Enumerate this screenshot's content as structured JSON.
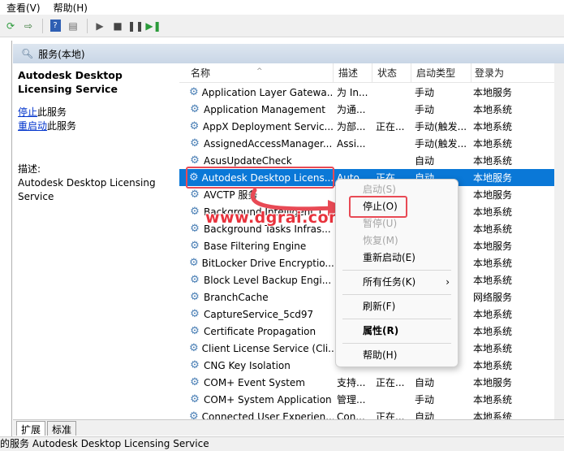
{
  "menubar": {
    "view": "查看(V)",
    "help": "帮助(H)"
  },
  "header": {
    "title": "服务(本地)"
  },
  "leftpane": {
    "service_name": "Autodesk Desktop Licensing Service",
    "stop_link": "停止",
    "stop_suffix": "此服务",
    "restart_link": "重启动",
    "restart_suffix": "此服务",
    "desc_label": "描述:",
    "desc_text": "Autodesk Desktop Licensing Service"
  },
  "columns": {
    "name": "名称",
    "desc": "描述",
    "status": "状态",
    "startup": "启动类型",
    "login": "登录为"
  },
  "rows": [
    {
      "name": "Application Layer Gatewa...",
      "desc": "为 In...",
      "status": "",
      "startup": "手动",
      "login": "本地服务"
    },
    {
      "name": "Application Management",
      "desc": "为通...",
      "status": "",
      "startup": "手动",
      "login": "本地系统"
    },
    {
      "name": "AppX Deployment Servic...",
      "desc": "为部...",
      "status": "正在...",
      "startup": "手动(触发...",
      "login": "本地系统"
    },
    {
      "name": "AssignedAccessManager...",
      "desc": "Assi...",
      "status": "",
      "startup": "手动(触发...",
      "login": "本地系统"
    },
    {
      "name": "AsusUpdateCheck",
      "desc": "",
      "status": "",
      "startup": "自动",
      "login": "本地系统"
    },
    {
      "name": "Autodesk Desktop Licens...",
      "desc": "Auto...",
      "status": "正在...",
      "startup": "自动",
      "login": "本地服务"
    },
    {
      "name": "AVCTP 服务",
      "desc": "",
      "status": "",
      "startup": "",
      "login": "本地服务"
    },
    {
      "name": "Background Intelligent T...",
      "desc": "",
      "status": "",
      "startup": "",
      "login": "本地系统"
    },
    {
      "name": "Background Tasks Infras...",
      "desc": "",
      "status": "",
      "startup": "",
      "login": "本地系统"
    },
    {
      "name": "Base Filtering Engine",
      "desc": "",
      "status": "",
      "startup": "",
      "login": "本地服务"
    },
    {
      "name": "BitLocker Drive Encryptio...",
      "desc": "",
      "status": "",
      "startup": "",
      "login": "本地系统"
    },
    {
      "name": "Block Level Backup Engi...",
      "desc": "",
      "status": "",
      "startup": "",
      "login": "本地系统"
    },
    {
      "name": "BranchCache",
      "desc": "",
      "status": "",
      "startup": "",
      "login": "网络服务"
    },
    {
      "name": "CaptureService_5cd97",
      "desc": "",
      "status": "",
      "startup": "",
      "login": "本地系统"
    },
    {
      "name": "Certificate Propagation",
      "desc": "",
      "status": "",
      "startup": "",
      "login": "本地系统"
    },
    {
      "name": "Client License Service (Cli...",
      "desc": "",
      "status": "",
      "startup": "",
      "login": "本地系统"
    },
    {
      "name": "CNG Key Isolation",
      "desc": "",
      "status": "",
      "startup": "",
      "login": "本地系统"
    },
    {
      "name": "COM+ Event System",
      "desc": "支持...",
      "status": "正在...",
      "startup": "自动",
      "login": "本地服务"
    },
    {
      "name": "COM+ System Application",
      "desc": "管理...",
      "status": "",
      "startup": "手动",
      "login": "本地系统"
    },
    {
      "name": "Connected User Experien...",
      "desc": "Con...",
      "status": "正在...",
      "startup": "自动",
      "login": "本地系统"
    }
  ],
  "contextmenu": {
    "start": "启动(S)",
    "stop": "停止(O)",
    "pause": "暂停(U)",
    "resume": "恢复(M)",
    "restart": "重新启动(E)",
    "alltasks": "所有任务(K)",
    "refresh": "刷新(F)",
    "properties": "属性(R)",
    "help": "帮助(H)"
  },
  "watermark": "www.dgrai.com",
  "tabs": {
    "extended": "扩展",
    "standard": "标准"
  },
  "statusbar": {
    "text": "的服务 Autodesk Desktop Licensing Service"
  },
  "colors": {
    "selection": "#0a78d7",
    "highlight": "#e84a55"
  }
}
